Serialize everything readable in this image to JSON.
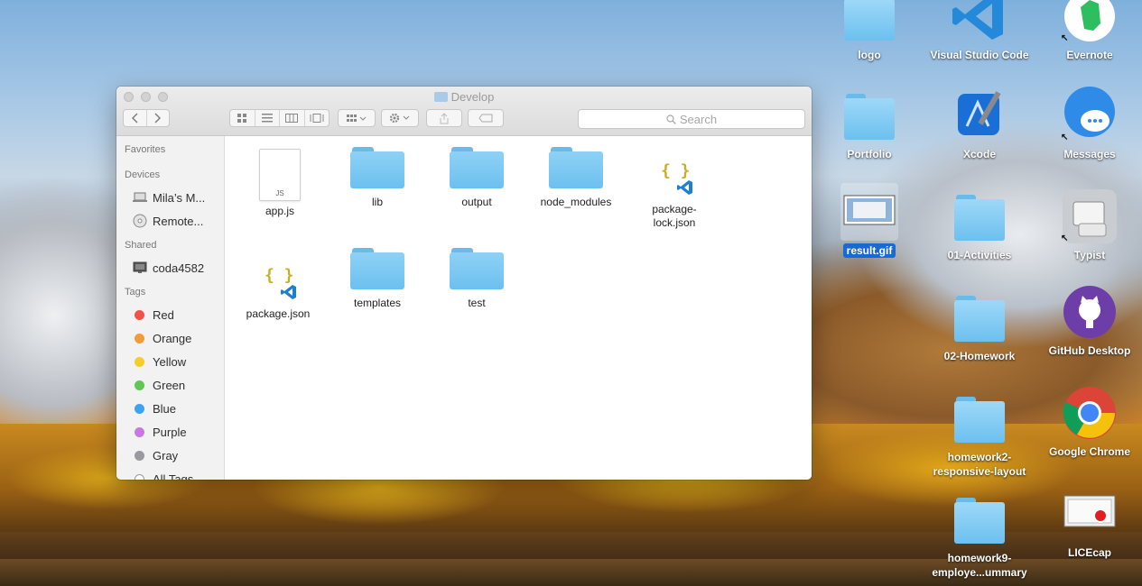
{
  "window": {
    "title": "Develop",
    "search_placeholder": "Search"
  },
  "sidebar": {
    "favorites_header": "Favorites",
    "devices_header": "Devices",
    "devices": [
      {
        "label": "Mila’s M...",
        "icon": "laptop-icon"
      },
      {
        "label": "Remote...",
        "icon": "disc-icon"
      }
    ],
    "shared_header": "Shared",
    "shared": [
      {
        "label": "coda4582",
        "icon": "monitor-icon"
      }
    ],
    "tags_header": "Tags",
    "tags": [
      {
        "label": "Red",
        "color": "#f0524a"
      },
      {
        "label": "Orange",
        "color": "#f29b38"
      },
      {
        "label": "Yellow",
        "color": "#f5cc2a"
      },
      {
        "label": "Green",
        "color": "#5dc853"
      },
      {
        "label": "Blue",
        "color": "#3aa3f2"
      },
      {
        "label": "Purple",
        "color": "#c878e0"
      },
      {
        "label": "Gray",
        "color": "#9a9a9e"
      },
      {
        "label": "All Tags...",
        "color": "#ffffff"
      }
    ]
  },
  "files": [
    {
      "name": "app.js",
      "kind": "js-file",
      "badge": "JS"
    },
    {
      "name": "lib",
      "kind": "folder"
    },
    {
      "name": "output",
      "kind": "folder"
    },
    {
      "name": "node_modules",
      "kind": "folder"
    },
    {
      "name_line1": "package-",
      "name_line2": "lock.json",
      "kind": "json-file",
      "braces": "{ }"
    },
    {
      "name": "package.json",
      "kind": "json-file",
      "braces": "{ }"
    },
    {
      "name": "templates",
      "kind": "folder"
    },
    {
      "name": "test",
      "kind": "folder"
    }
  ],
  "desktop": [
    {
      "label": "logo",
      "icon": "folder-icon"
    },
    {
      "label": "Visual Studio Code",
      "icon": "vscode-icon"
    },
    {
      "label": "Evernote",
      "icon": "evernote-icon"
    },
    {
      "label": "Portfolio",
      "icon": "folder-icon"
    },
    {
      "label": "Xcode",
      "icon": "xcode-icon"
    },
    {
      "label": "Messages",
      "icon": "messages-icon"
    },
    {
      "label": "result.gif",
      "icon": "gif-thumbnail-icon"
    },
    {
      "label": "01-Activities",
      "icon": "folder-icon"
    },
    {
      "label": "Typist",
      "icon": "typist-icon"
    },
    {
      "label": "02-Homework",
      "icon": "folder-icon"
    },
    {
      "label": "GitHub Desktop",
      "icon": "github-icon"
    },
    {
      "label_line1": "homework2-",
      "label_line2": "responsive-layout",
      "icon": "folder-icon"
    },
    {
      "label": "Google Chrome",
      "icon": "chrome-icon"
    },
    {
      "label_line1": "homework9-",
      "label_line2": "employe...ummary",
      "icon": "folder-icon"
    },
    {
      "label": "LICEcap",
      "icon": "licecap-icon"
    }
  ]
}
